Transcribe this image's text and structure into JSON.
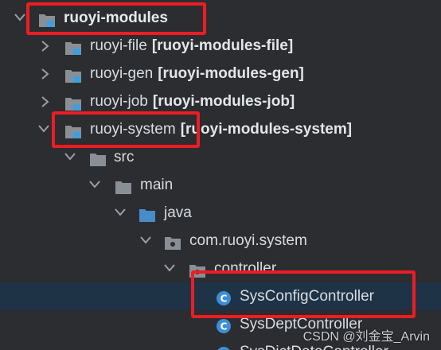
{
  "tree": {
    "root": {
      "label": "ruoyi-modules"
    },
    "modules": [
      {
        "name": "ruoyi-file",
        "artifact": "[ruoyi-modules-file]"
      },
      {
        "name": "ruoyi-gen",
        "artifact": "[ruoyi-modules-gen]"
      },
      {
        "name": "ruoyi-job",
        "artifact": "[ruoyi-modules-job]"
      },
      {
        "name": "ruoyi-system",
        "artifact": "[ruoyi-modules-system]"
      }
    ],
    "folders": {
      "src": "src",
      "main": "main",
      "java": "java",
      "package": "com.ruoyi.system",
      "controller": "controller"
    },
    "classes": [
      "SysConfigController",
      "SysDeptController",
      "SysDictDataController"
    ]
  },
  "watermark": "CSDN @刘金宝_Arvin",
  "colors": {
    "background": "#2b2d30",
    "selection": "#1f3347",
    "highlight_box": "#ee1c23",
    "folder": "#8a8f96",
    "module_marker": "#3d9ee0",
    "source_folder": "#4a8cc8",
    "class_icon": "#3d8ed6"
  }
}
